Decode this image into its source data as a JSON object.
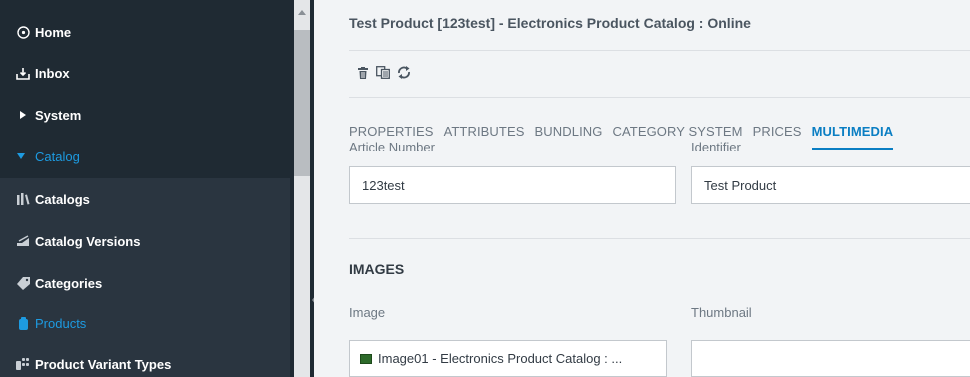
{
  "sidebar": {
    "items": [
      {
        "label": "Home",
        "icon": "home-icon"
      },
      {
        "label": "Inbox",
        "icon": "inbox-icon"
      },
      {
        "label": "System",
        "icon": "caret-right-icon"
      },
      {
        "label": "Catalog",
        "icon": "caret-down-icon",
        "active": true
      },
      {
        "label": "Catalogs",
        "icon": "catalogs-icon"
      },
      {
        "label": "Catalog Versions",
        "icon": "catalog-versions-icon"
      },
      {
        "label": "Categories",
        "icon": "tag-icon"
      },
      {
        "label": "Products",
        "icon": "product-icon",
        "active": true
      },
      {
        "label": "Product Variant Types",
        "icon": "variant-types-icon"
      }
    ],
    "active_color": "#1d9be1"
  },
  "main": {
    "title": "Test Product [123test] - Electronics Product Catalog : Online",
    "toolbar": [
      "delete-icon",
      "clone-icon",
      "refresh-icon"
    ],
    "tabs": [
      {
        "label": "PROPERTIES"
      },
      {
        "label": "ATTRIBUTES"
      },
      {
        "label": "BUNDLING"
      },
      {
        "label": "CATEGORY SYSTEM"
      },
      {
        "label": "PRICES"
      },
      {
        "label": "MULTIMEDIA",
        "active": true
      }
    ],
    "clipped_labels": {
      "article_number": "Article Number",
      "identifier": "Identifier"
    },
    "fields": {
      "article_number": "123test",
      "identifier": "Test Product"
    },
    "images_section": {
      "title": "IMAGES",
      "image_label": "Image",
      "thumbnail_label": "Thumbnail",
      "image_value": "Image01 - Electronics Product Catalog : ...",
      "thumbnail_value": ""
    },
    "accent_color": "#0a7ec3"
  }
}
